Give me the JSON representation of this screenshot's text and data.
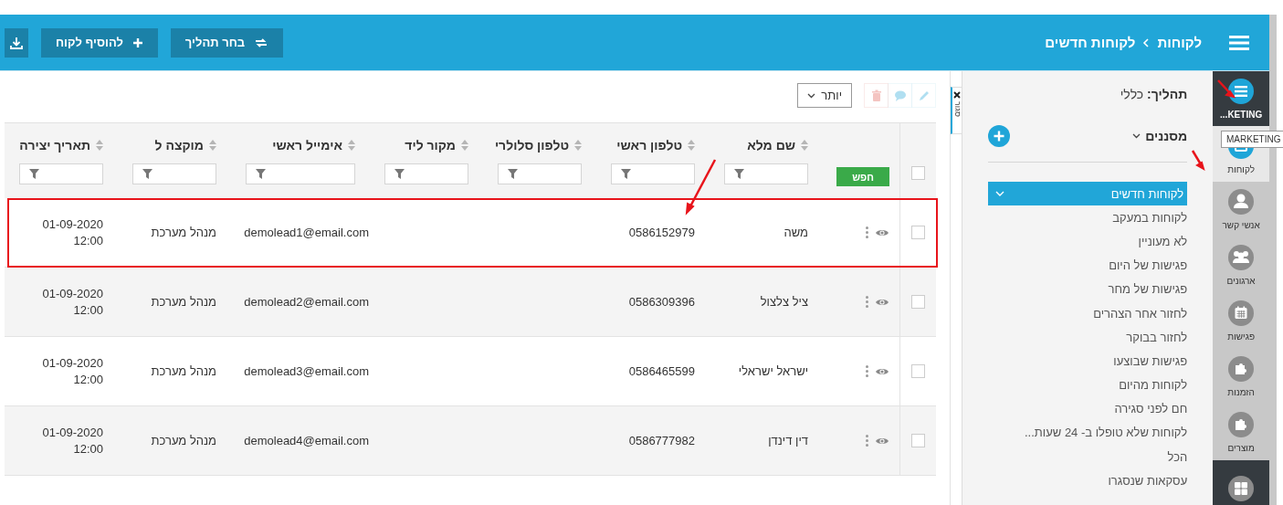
{
  "header": {
    "breadcrumb": [
      {
        "label": "לקוחות"
      },
      {
        "label": "לקוחות חדשים"
      }
    ],
    "buttons": [
      {
        "kind": "process",
        "label": "בחר תהליך"
      },
      {
        "kind": "add",
        "label": "להוסיף לקוח"
      },
      {
        "kind": "download"
      }
    ]
  },
  "rail": {
    "items": [
      {
        "kind": "menu",
        "label": "...KETING",
        "selected": false
      },
      {
        "kind": "clients",
        "label": "לקוחות",
        "selected": true
      },
      {
        "kind": "contacts",
        "label": "אנשי קשר",
        "selected": false
      },
      {
        "kind": "orgs",
        "label": "ארגונים",
        "selected": false
      },
      {
        "kind": "meetings",
        "label": "פגישות",
        "selected": false
      },
      {
        "kind": "orders",
        "label": "הזמנות",
        "selected": false
      },
      {
        "kind": "products",
        "label": "מוצרים",
        "selected": false
      },
      {
        "kind": "dashboard",
        "selected": false
      }
    ]
  },
  "tooltip": "MARKETING",
  "sidebar": {
    "process": "**תהליך:** כללי",
    "filters_label": "מסננים",
    "filters_expanded": true,
    "views": [
      {
        "label": "לקוחות חדשים",
        "selected": true
      },
      {
        "label": "לקוחות במעקב",
        "selected": false
      },
      {
        "label": "לא מעוניין",
        "selected": false
      },
      {
        "label": "פגישות של היום",
        "selected": false
      },
      {
        "label": "פגישות של מחר",
        "selected": false
      },
      {
        "label": "לחזור אחר הצהרים",
        "selected": false
      },
      {
        "label": "לחזור בבוקר",
        "selected": false
      },
      {
        "label": "פגישות שבוצעו",
        "selected": false
      },
      {
        "label": "לקוחות מהיום",
        "selected": false
      },
      {
        "label": "חם לפני סגירה",
        "selected": false
      },
      {
        "label": "לקוחות שלא טופלו ב- 24 שעות...",
        "selected": false
      },
      {
        "label": "הכל",
        "selected": false
      },
      {
        "label": "עסקאות שנסגרו",
        "selected": false
      }
    ]
  },
  "close_tab": "סגור",
  "toolbar": {
    "more": "יותר",
    "actions": [
      {
        "kind": "edit",
        "disabled": true
      },
      {
        "kind": "comment",
        "disabled": true
      },
      {
        "kind": "delete",
        "disabled": true
      }
    ]
  },
  "table": {
    "search_button": "חפש",
    "header_checked": false,
    "columns": [
      {
        "label": "שם מלא"
      },
      {
        "label": "טלפון ראשי"
      },
      {
        "label": "טלפון סלולרי"
      },
      {
        "label": "מקור ליד"
      },
      {
        "label": "אימייל ראשי"
      },
      {
        "label": "מוקצה ל"
      },
      {
        "label": "תאריך יצירה"
      }
    ],
    "rows": [
      {
        "checked": false,
        "highlighted": true,
        "cells": [
          "משה",
          "0586152979",
          null,
          null,
          "demolead1@email.com",
          "מנהל מערכת",
          [
            "01-09-2020",
            "12:00"
          ]
        ]
      },
      {
        "checked": false,
        "highlighted": false,
        "cells": [
          "ציל צלצול",
          "0586309396",
          null,
          null,
          "demolead2@email.com",
          "מנהל מערכת",
          [
            "01-09-2020",
            "12:00"
          ]
        ]
      },
      {
        "checked": false,
        "highlighted": false,
        "cells": [
          "ישראל ישראלי",
          "0586465599",
          null,
          null,
          "demolead3@email.com",
          "מנהל מערכת",
          [
            "01-09-2020",
            "12:00"
          ]
        ]
      },
      {
        "checked": false,
        "highlighted": false,
        "cells": [
          "דין דינדן",
          "0586777982",
          null,
          null,
          "demolead4@email.com",
          "מנהל מערכת",
          [
            "01-09-2020",
            "12:00"
          ]
        ]
      }
    ]
  }
}
